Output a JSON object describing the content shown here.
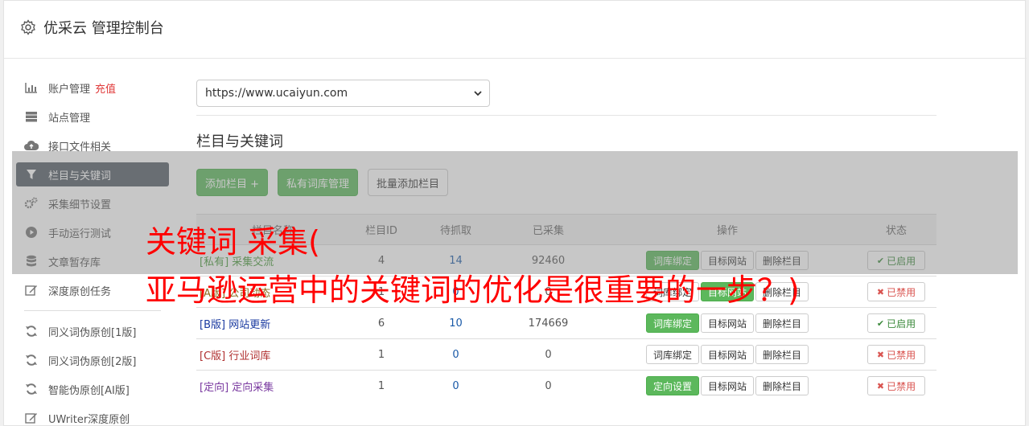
{
  "header": {
    "title": "优采云 管理控制台",
    "icon": "gear-icon"
  },
  "sidebar": {
    "group1": [
      {
        "label": "账户管理",
        "extra": "充值",
        "icon": "bar-chart-icon"
      },
      {
        "label": "站点管理",
        "icon": "server-icon"
      },
      {
        "label": "接口文件相关",
        "icon": "cloud-upload-icon"
      },
      {
        "label": "栏目与关键词",
        "icon": "filter-icon",
        "active": true
      },
      {
        "label": "采集细节设置",
        "icon": "cogs-icon"
      },
      {
        "label": "手动运行测试",
        "icon": "play-circle-icon"
      },
      {
        "label": "文章暂存库",
        "icon": "database-icon"
      },
      {
        "label": "深度原创任务",
        "icon": "edit-icon"
      }
    ],
    "group2": [
      {
        "label": "同义词伪原创[1版]",
        "icon": "refresh-icon"
      },
      {
        "label": "同义词伪原创[2版]",
        "icon": "refresh-icon"
      },
      {
        "label": "智能伪原创[AI版]",
        "icon": "refresh-icon"
      },
      {
        "label": "UWriter深度原创",
        "icon": "edit-icon"
      }
    ]
  },
  "site_select": {
    "value": "https://www.ucaiyun.com"
  },
  "section": {
    "title": "栏目与关键词"
  },
  "buttons": {
    "add_category": "添加栏目 +",
    "private_lib": "私有词库管理",
    "batch_add": "批量添加栏目"
  },
  "table": {
    "headers": {
      "name": "栏目名称",
      "id": "栏目ID",
      "pending": "待抓取",
      "collected": "已采集",
      "ops": "操作",
      "status": "状态"
    },
    "rows": [
      {
        "tag": "[私有]",
        "name": "采集交流",
        "id": "4",
        "pending": "14",
        "collected": "92460",
        "op1": "词库绑定",
        "op2": "目标网站",
        "op3": "删除栏目",
        "status": "已启用"
      },
      {
        "tag": "[A版]",
        "name": "公司动态",
        "id": "1",
        "pending": "0",
        "collected": "0",
        "op1": "词库绑定",
        "op2": "目标网站",
        "op3": "删除栏目",
        "status": "已禁用"
      },
      {
        "tag": "[B版]",
        "name": "网站更新",
        "id": "6",
        "pending": "10",
        "collected": "174669",
        "op1": "词库绑定",
        "op2": "目标网站",
        "op3": "删除栏目",
        "status": "已启用"
      },
      {
        "tag": "[C版]",
        "name": "行业词库",
        "id": "1",
        "pending": "0",
        "collected": "0",
        "op1": "词库绑定",
        "op2": "目标网站",
        "op3": "删除栏目",
        "status": "已禁用"
      },
      {
        "tag": "[定向]",
        "name": "定向采集",
        "id": "1",
        "pending": "0",
        "collected": "0",
        "op1": "定向设置",
        "op2": "目标网站",
        "op3": "删除栏目",
        "status": "已禁用"
      }
    ]
  },
  "watermark": {
    "line1": "关键词 采集(",
    "line2": "亚马逊运营中的关键词的优化是很重要的一步？)"
  },
  "colors": {
    "accent_green": "#5cb85c",
    "nav_active": "#555d66",
    "watermark": "#ff0000"
  }
}
